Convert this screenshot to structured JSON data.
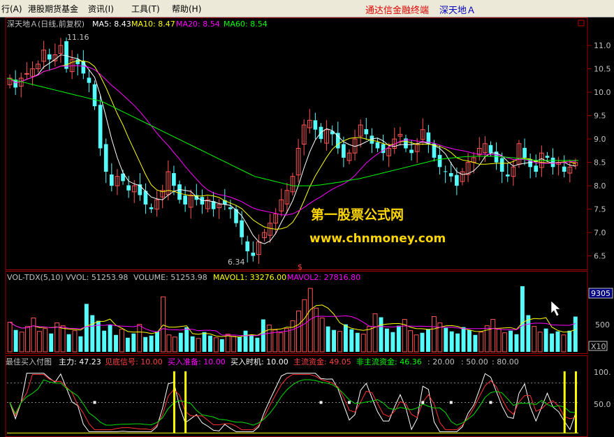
{
  "menubar": {
    "items": [
      "行(A)",
      "港股期货基金",
      "资讯(I)",
      "工具(T)",
      "帮助(H)"
    ],
    "brand": "通达信金融终端",
    "stock_name": "深天地Ａ"
  },
  "main_panel": {
    "title": "深天地Ａ(日线,前复权)",
    "ma5": "MA5: 8.43",
    "ma10": "MA10: 8.47",
    "ma20": "MA20: 8.54",
    "ma60": "MA60: 8.54",
    "high_marker": "11.16",
    "low_marker": "6.34",
    "s_marker": "$",
    "y_ticks": [
      "11.0",
      "10.5",
      "10.0",
      "9.5",
      "9.0",
      "8.5",
      "8.0",
      "7.5",
      "7.0",
      "6.5"
    ]
  },
  "volume_panel": {
    "title": "VOL-TDX(5,10)",
    "vvol": "VVOL: 51253.98",
    "volume": "VOLUME: 51253.98",
    "mavol1": "MAVOL1: 33276.00",
    "mavol2": "MAVOL2: 27816.80",
    "y_top": "9305",
    "y_mid": "500",
    "unit": "X10"
  },
  "indicator_panel": {
    "title": "最佳买入付图",
    "zhuli": "主力: 47.23",
    "jiandi": "见底信号: 10.00",
    "mairu_zhunbei": "买入准备: 10.00",
    "mairu_shiji": "买入时机: 10.00",
    "zhuliu": "主流资金: 49.05",
    "fei_zhuliu": "非主流资金: 46.36",
    "v20": ": 20.00",
    "v50": ": 50.00",
    "v80": ": 80.00",
    "y_ticks": [
      "100.",
      "50.0"
    ]
  },
  "watermark": {
    "line1": "第一股票公式网",
    "line2": "www.chnmoney.com"
  },
  "colors": {
    "up": "#FF5555",
    "down": "#54FCFC",
    "ma5": "#FFFFFF",
    "ma10": "#FFFF00",
    "ma20": "#FF00FF",
    "ma60": "#00FF00",
    "grid": "#800000"
  },
  "chart_data": {
    "type": "candlestick",
    "price_range": [
      6.3,
      11.3
    ],
    "closes": [
      10.3,
      10.1,
      10.3,
      10.4,
      10.5,
      10.6,
      10.9,
      10.7,
      10.8,
      11.0,
      10.5,
      10.7,
      10.6,
      10.4,
      10.2,
      9.7,
      8.8,
      8.3,
      8.0,
      8.2,
      8.1,
      7.9,
      8.0,
      7.8,
      7.6,
      7.5,
      7.7,
      7.9,
      8.3,
      8.0,
      7.7,
      7.6,
      7.8,
      7.7,
      7.6,
      7.7,
      7.5,
      7.6,
      7.6,
      7.5,
      7.2,
      6.9,
      6.6,
      6.5,
      6.8,
      7.0,
      7.2,
      7.4,
      7.7,
      7.9,
      8.2,
      8.8,
      9.3,
      9.4,
      9.2,
      9.0,
      9.2,
      9.1,
      8.8,
      8.6,
      8.7,
      9.0,
      9.3,
      9.1,
      8.9,
      8.8,
      8.7,
      8.8,
      9.0,
      9.1,
      8.8,
      8.7,
      8.9,
      9.2,
      8.9,
      8.6,
      8.4,
      8.3,
      8.2,
      8.0,
      8.3,
      8.5,
      8.6,
      8.8,
      8.9,
      8.7,
      8.5,
      8.3,
      8.2,
      8.4,
      8.9,
      8.6,
      8.4,
      8.3,
      8.7,
      8.6,
      8.4,
      8.5,
      8.3,
      8.4,
      8.5
    ],
    "ma60": [
      10.3,
      10.25,
      10.2,
      10.15,
      10.1,
      10.05,
      10.0,
      9.95,
      9.9,
      9.85,
      9.8,
      9.7,
      9.6,
      9.5,
      9.4,
      9.3,
      9.2,
      9.1,
      9.0,
      8.9,
      8.8,
      8.7,
      8.6,
      8.5,
      8.4,
      8.3,
      8.2,
      8.15,
      8.1,
      8.05,
      8.0,
      8.0,
      8.0,
      8.02,
      8.05,
      8.08,
      8.12,
      8.15,
      8.2,
      8.25,
      8.3,
      8.35,
      8.4,
      8.45,
      8.5,
      8.55,
      8.58,
      8.6,
      8.62,
      8.63,
      8.63,
      8.63,
      8.62,
      8.6,
      8.58,
      8.55,
      8.54,
      8.54,
      8.54,
      8.54,
      8.54
    ],
    "volume_bars": [
      4200,
      3100,
      2800,
      3600,
      4800,
      2900,
      3300,
      2600,
      4100,
      3700,
      2500,
      3000,
      2200,
      6800,
      5200,
      4400,
      3000,
      3800,
      2400,
      3200,
      2000,
      2600,
      3900,
      2100,
      2300,
      2900,
      7800,
      2400,
      2100,
      2700,
      3500,
      2200,
      1900,
      2800,
      2300,
      2000,
      1800,
      2500,
      2200,
      2100,
      3000,
      2400,
      2000,
      4600,
      3800,
      3100,
      2700,
      3300,
      4400,
      5800,
      7400,
      9000,
      6200,
      4800,
      3600,
      3100,
      2900,
      3900,
      3200,
      2700,
      2500,
      3600,
      5400,
      4900,
      3300,
      2800,
      3700,
      4600,
      3000,
      2400,
      2700,
      3200,
      5000,
      4100,
      3400,
      2900,
      2600,
      3500,
      3100,
      2400,
      2800,
      3700,
      4600,
      3200,
      2700,
      3000,
      2500,
      9305,
      5200,
      3600,
      2800,
      3300,
      2600,
      2900,
      2400,
      3000,
      5000
    ]
  }
}
